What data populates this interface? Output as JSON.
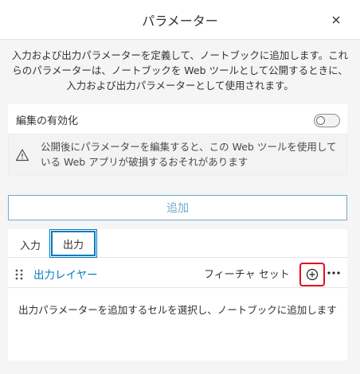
{
  "panel": {
    "title": "パラメーター",
    "close_icon": "close-icon"
  },
  "description": "入力および出力パラメーターを定義して、ノートブックに追加します。これらのパラメーターは、ノートブックを Web ツールとして公開するときに、入力および出力パラメーターとして使用されます。",
  "edit": {
    "label": "編集の有効化",
    "toggle_on": false,
    "warning_icon": "warning-triangle-icon",
    "warning_text": "公開後にパラメーターを編集すると、この Web ツールを使用している Web アプリが破損するおそれがあります"
  },
  "add_button_label": "追加",
  "tabs": [
    {
      "label": "入力",
      "selected": false
    },
    {
      "label": "出力",
      "selected": true
    }
  ],
  "parameters": [
    {
      "name": "出力レイヤー",
      "type": "フィーチャ セット",
      "drag_icon": "drag-handle-icon",
      "add_icon": "add-circle-icon",
      "more_icon": "more-horizontal-icon"
    }
  ],
  "hint": "出力パラメーターを追加するセルを選択し、ノートブックに追加します",
  "colors": {
    "accent": "#007ac2",
    "add_button_text": "#6fa9cf",
    "highlight": "#e0101f",
    "background": "#f5f5f5"
  }
}
